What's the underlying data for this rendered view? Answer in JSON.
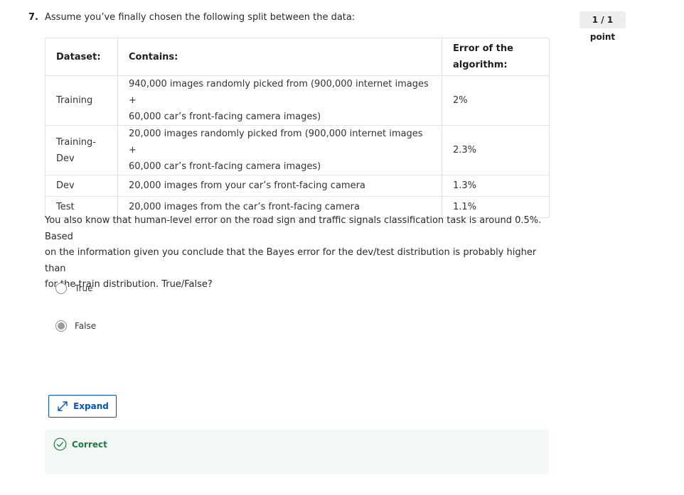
{
  "question": {
    "number": "7.",
    "text": "Assume you’ve finally chosen the following split between the data:",
    "points": "1 / 1 point"
  },
  "table": {
    "headers": {
      "dataset": "Dataset:",
      "contains": "Contains:",
      "error_l1": "Error of the",
      "error_l2": "algorithm:"
    },
    "rows": [
      {
        "dataset_l1": "Training",
        "dataset_l2": "",
        "contains_l1": "940,000 images randomly picked from (900,000 internet images +",
        "contains_l2": "60,000 car’s front-facing camera images)",
        "error": "2%"
      },
      {
        "dataset_l1": "Training-",
        "dataset_l2": "Dev",
        "contains_l1": "20,000 images randomly picked from (900,000 internet images +",
        "contains_l2": "60,000 car’s front-facing camera images)",
        "error": "2.3%"
      },
      {
        "dataset_l1": "Dev",
        "dataset_l2": "",
        "contains_l1": "20,000 images from your car’s front-facing camera",
        "contains_l2": "",
        "error": "1.3%"
      },
      {
        "dataset_l1": "Test",
        "dataset_l2": "",
        "contains_l1": "20,000 images from the car’s front-facing camera",
        "contains_l2": "",
        "error": "1.1%"
      }
    ]
  },
  "paragraph": {
    "line1": "You also know that human-level error on the road sign and traffic signals classification task is around 0.5%. Based",
    "line2": "on the information given you conclude that the Bayes error for the dev/test distribution is probably higher than",
    "line3": "for the train distribution. True/False?"
  },
  "options": [
    {
      "label": "True",
      "selected": false
    },
    {
      "label": "False",
      "selected": true
    }
  ],
  "expand_label": "Expand",
  "feedback": {
    "label": "Correct",
    "color": "#1f7a44"
  },
  "colors": {
    "accent": "#0056d2",
    "success_bg": "#f2f8f4"
  }
}
